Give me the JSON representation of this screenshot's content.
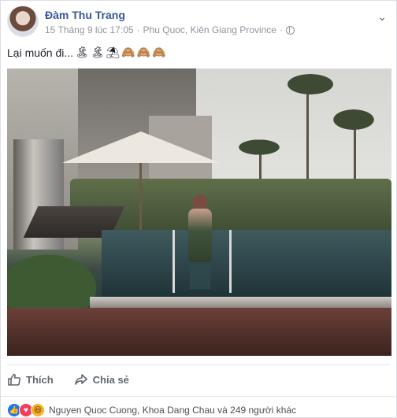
{
  "post": {
    "author": "Đàm Thu Trang",
    "timestamp": "15 Tháng 9 lúc 17:05",
    "separator": "·",
    "location": "Phu Quoc, Kiên Giang Province",
    "privacy_icon": "globe-icon",
    "menu_icon": "chevron-down-icon",
    "caption": "Lại muốn đi...",
    "caption_emojis": [
      "🏝",
      "🏝",
      "⛱",
      "🙈",
      "🙈",
      "🙈"
    ]
  },
  "actions": {
    "like_label": "Thích",
    "share_label": "Chia sẻ"
  },
  "reactions": {
    "icons": [
      "like",
      "love",
      "haha"
    ],
    "summary": "Nguyen Quoc Cuong, Khoa Dang Chau và 249 người khác"
  },
  "colors": {
    "author": "#365899",
    "meta": "#90949c",
    "like_reaction": "#1877f2",
    "love_reaction": "#f33e58",
    "haha_reaction": "#f7b125"
  }
}
